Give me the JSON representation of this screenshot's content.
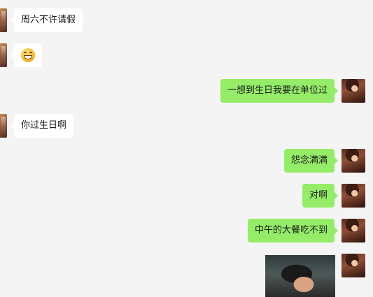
{
  "messages": [
    {
      "side": "left",
      "type": "text",
      "text": "周六不许请假"
    },
    {
      "side": "left",
      "type": "emoji",
      "emoji": "grin-emoji"
    },
    {
      "side": "right",
      "type": "text",
      "text": "一想到生日我要在单位过"
    },
    {
      "side": "left",
      "type": "text",
      "text": "你过生日啊"
    },
    {
      "side": "right",
      "type": "text",
      "text": "怨念满满"
    },
    {
      "side": "right",
      "type": "text",
      "text": "对啊"
    },
    {
      "side": "right",
      "type": "text",
      "text": "中午的大餐吃不到"
    },
    {
      "side": "right",
      "type": "image",
      "image": "photo-thumbnail"
    }
  ],
  "colors": {
    "background": "#f4f4f4",
    "incoming_bubble": "#ffffff",
    "outgoing_bubble": "#95ec69"
  }
}
